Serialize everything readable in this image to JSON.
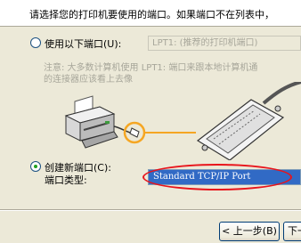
{
  "header": {
    "instruction": "请选择您的打印机要使用的端口。如果端口不在列表中，"
  },
  "use_existing": {
    "radio_label": "使用以下端口",
    "shortcut": "(U):",
    "combo_value": "LPT1: (推荐的打印机端口)",
    "note_line1": "注意: 大多数计算机使用 LPT1: 端口来跟本地计算机通",
    "note_line2": "的连接器应该看上去像"
  },
  "create_new": {
    "radio_label": "创建新端口",
    "shortcut": "(C):",
    "type_label": "端口类型:",
    "type_value": "Standard TCP/IP Port"
  },
  "buttons": {
    "back": "< 上一步(B)",
    "next": "下一"
  },
  "colors": {
    "highlight": "#316ac5",
    "annotation": "#e8141b",
    "callout": "#f5a623"
  }
}
